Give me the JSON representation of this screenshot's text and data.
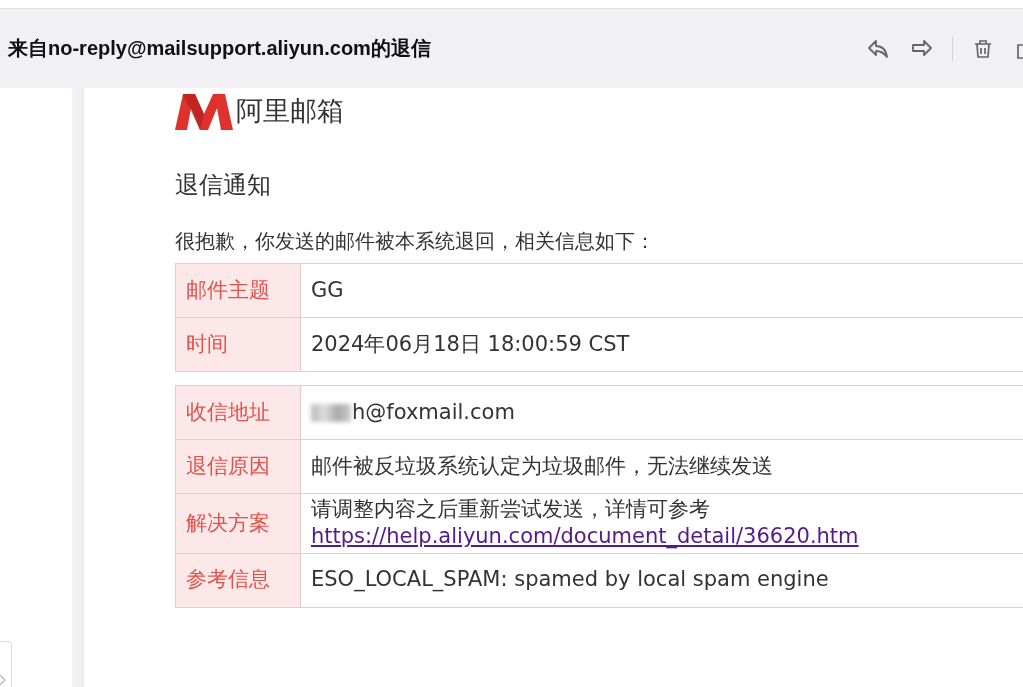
{
  "header": {
    "title": "来自no-reply@mailsupport.aliyun.com的退信"
  },
  "mail": {
    "brand": "阿里邮箱",
    "heading": "退信通知",
    "intro": "很抱歉，你发送的邮件被本系统退回，相关信息如下：",
    "sections": [
      {
        "rows": [
          {
            "label": "邮件主题",
            "value": "GG"
          },
          {
            "label": "时间",
            "value": "2024年06月18日 18:00:59 CST"
          }
        ]
      },
      {
        "rows": [
          {
            "label": "收信地址",
            "value": "h@foxmail.com",
            "redacted": true
          },
          {
            "label": "退信原因",
            "value": "邮件被反垃圾系统认定为垃圾邮件，无法继续发送"
          },
          {
            "label": "解决方案",
            "value": "请调整内容之后重新尝试发送，详情可参考",
            "link": "https://help.aliyun.com/document_detail/36620.htm"
          },
          {
            "label": "参考信息",
            "value": "ESO_LOCAL_SPAM: spamed by local spam engine"
          }
        ]
      }
    ]
  }
}
